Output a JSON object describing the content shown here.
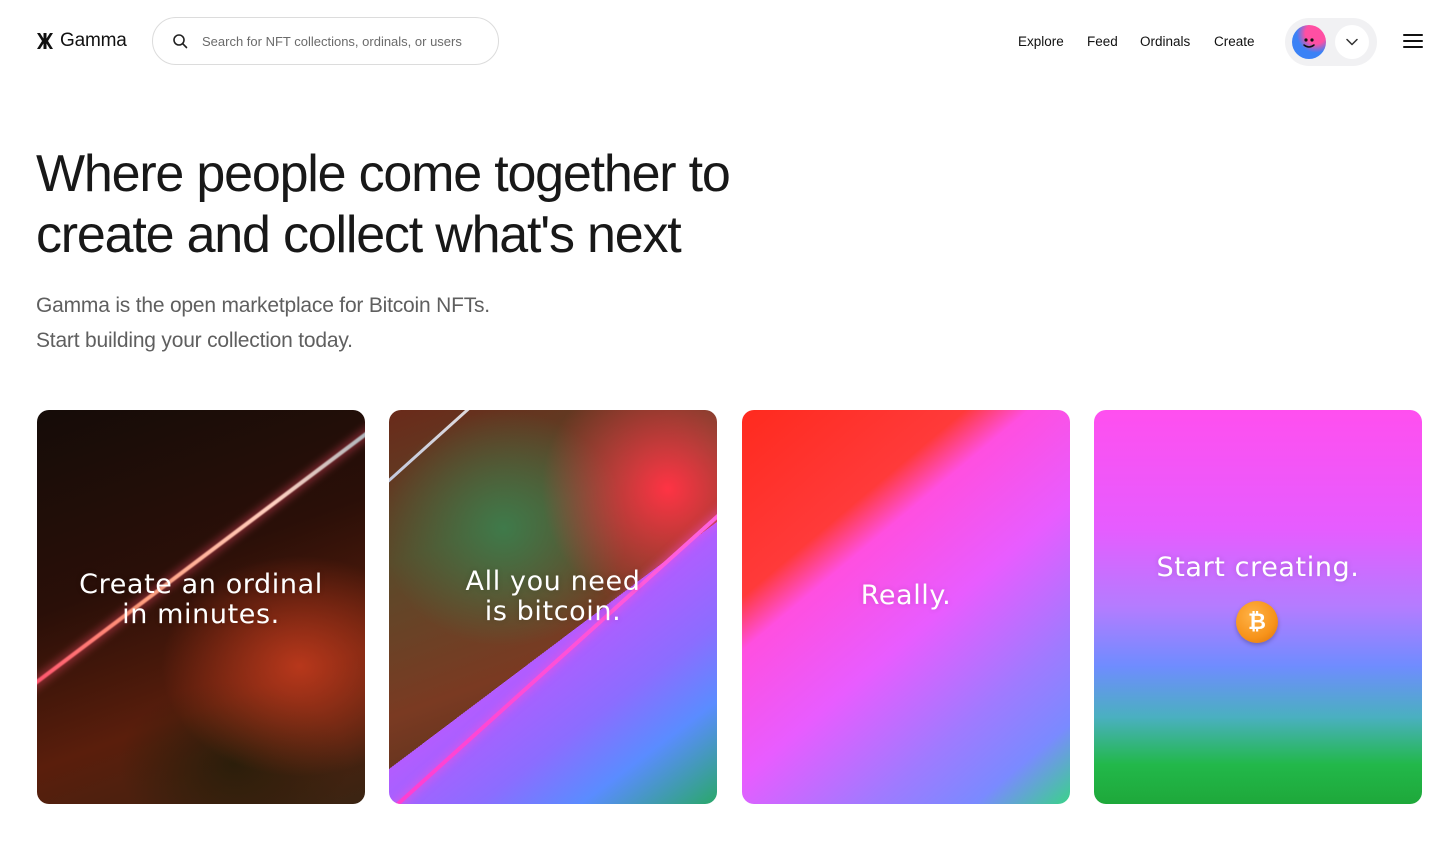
{
  "header": {
    "brand": "Gamma",
    "search": {
      "placeholder": "Search for NFT collections, ordinals, or users",
      "value": ""
    },
    "nav": [
      "Explore",
      "Feed",
      "Ordinals",
      "Create"
    ]
  },
  "hero": {
    "title_line1": "Where people come together to",
    "title_line2": "create and collect what's next",
    "subtitle_line1": "Gamma is the open marketplace for Bitcoin NFTs.",
    "subtitle_line2": "Start building your collection today."
  },
  "cards": [
    {
      "caption": "Create an ordinal\nin minutes."
    },
    {
      "caption": "All you need\nis bitcoin."
    },
    {
      "caption": "Really."
    },
    {
      "caption": "Start creating.",
      "badge": "₿"
    }
  ],
  "colors": {
    "bitcoin_orange": "#f7931a",
    "avatar_blue": "#3b82f6",
    "avatar_pink": "#ff4fa3"
  },
  "icons": {
    "logo": "gamma-logo-icon",
    "search": "search-icon",
    "account_dropdown": "chevron-down-icon",
    "menu": "hamburger-menu-icon",
    "bitcoin": "bitcoin-icon"
  }
}
